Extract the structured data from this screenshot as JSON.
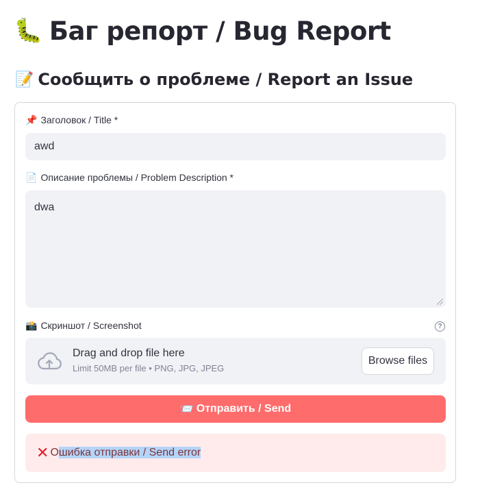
{
  "header": {
    "title": "Баг репорт / Bug Report",
    "title_icon": "🐛",
    "subheader": "Сообщить о проблеме / Report an Issue",
    "subheader_icon": "📝"
  },
  "form": {
    "title_field": {
      "icon": "📌",
      "label": "Заголовок / Title *",
      "value": "awd"
    },
    "description_field": {
      "icon": "📄",
      "label": "Описание проблемы / Problem Description *",
      "value": "dwa"
    },
    "screenshot_field": {
      "icon": "📸",
      "label": "Скриншот / Screenshot",
      "help": "?",
      "dropzone_title": "Drag and drop file here",
      "dropzone_limit": "Limit 50MB per file • PNG, JPG, JPEG",
      "browse_label": "Browse files"
    },
    "submit": {
      "icon": "📨",
      "label": "Отправить / Send"
    },
    "error": {
      "icon": "❌",
      "text_first_char": "О",
      "text_rest": "шибка отправки / Send error",
      "color": "#e0202f"
    }
  },
  "colors": {
    "primary_button": "#ff6c6c",
    "error_bg": "#ffebeb",
    "input_bg": "#f0f2f6",
    "selection_highlight": "#b4d4f8"
  }
}
